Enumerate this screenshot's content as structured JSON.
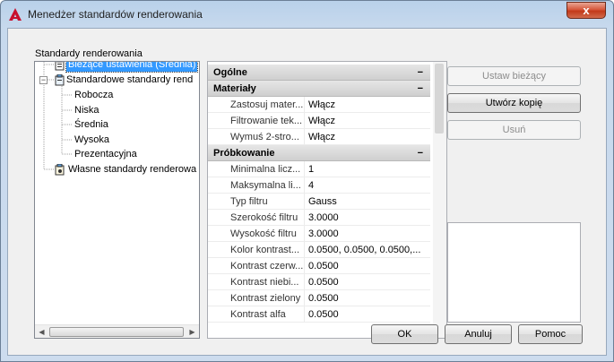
{
  "window": {
    "title": "Menedżer standardów renderowania",
    "close_label": "x"
  },
  "left_panel": {
    "label": "Standardy renderowania"
  },
  "tree": {
    "items": [
      {
        "label": "Bieżące ustawienia (Średnia)",
        "selected": true,
        "icon": "current-settings-icon"
      },
      {
        "label": "Standardowe standardy rend",
        "icon": "standard-presets-icon",
        "expander": "−"
      },
      {
        "label": "Robocza"
      },
      {
        "label": "Niska"
      },
      {
        "label": "Średnia"
      },
      {
        "label": "Wysoka"
      },
      {
        "label": "Prezentacyjna"
      },
      {
        "label": "Własne standardy renderowa",
        "icon": "custom-presets-icon"
      }
    ]
  },
  "properties": {
    "categories": [
      {
        "name": "Ogólne",
        "collapse": "−",
        "rows": []
      },
      {
        "name": "Materiały",
        "collapse": "−",
        "rows": [
          {
            "name": "Zastosuj mater...",
            "value": "Włącz"
          },
          {
            "name": "Filtrowanie tek...",
            "value": "Włącz"
          },
          {
            "name": "Wymuś 2-stro...",
            "value": "Włącz"
          }
        ]
      },
      {
        "name": "Próbkowanie",
        "collapse": "−",
        "rows": [
          {
            "name": "Minimalna licz...",
            "value": "1"
          },
          {
            "name": "Maksymalna li...",
            "value": "4"
          },
          {
            "name": "Typ filtru",
            "value": "Gauss"
          },
          {
            "name": "Szerokość filtru",
            "value": "3.0000"
          },
          {
            "name": "Wysokość filtru",
            "value": "3.0000"
          },
          {
            "name": "Kolor kontrast...",
            "value": "0.0500, 0.0500, 0.0500,..."
          },
          {
            "name": "Kontrast czerw...",
            "value": "0.0500"
          },
          {
            "name": "Kontrast niebi...",
            "value": "0.0500"
          },
          {
            "name": "Kontrast zielony",
            "value": "0.0500"
          },
          {
            "name": "Kontrast alfa",
            "value": "0.0500"
          }
        ]
      }
    ]
  },
  "buttons": {
    "set_current": "Ustaw bieżący",
    "create_copy": "Utwórz kopię",
    "delete": "Usuń",
    "ok": "OK",
    "cancel": "Anuluj",
    "help": "Pomoc"
  },
  "colors": {
    "selection": "#3399ff",
    "close_button": "#c7432a"
  }
}
